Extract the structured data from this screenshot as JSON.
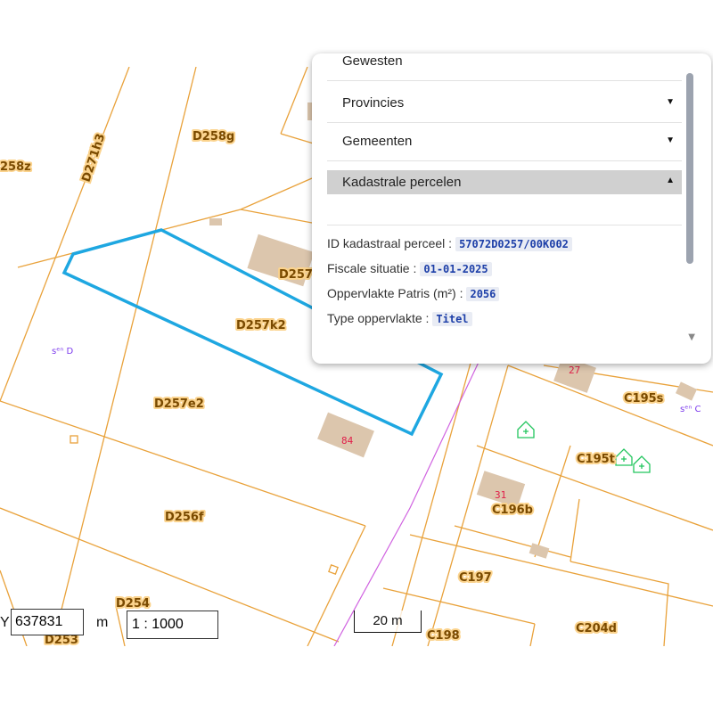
{
  "map": {
    "parcel_labels": [
      "D258g",
      "258z",
      "D271h3",
      "D257",
      "D257k2",
      "D257e2",
      "D256f",
      "D254",
      "D253",
      "C195s",
      "C195t",
      "C196b",
      "C197",
      "C198",
      "C204d"
    ],
    "house_numbers": [
      "84",
      "27",
      "31"
    ],
    "section_labels": [
      "sᵉⁿ D",
      "sᵉⁿ C"
    ],
    "selected_parcel": "D257k2",
    "colors": {
      "parcel_line": "#e9a23b",
      "highlight": "#1ea7e1",
      "building": "#dcc6ad",
      "road_line": "#d062e0",
      "label_halo": "#fbd38d",
      "label_text": "#7a4a00"
    }
  },
  "panel": {
    "sections": [
      {
        "label": "Gewesten",
        "expanded": false
      },
      {
        "label": "Provincies",
        "expanded": false
      },
      {
        "label": "Gemeenten",
        "expanded": false
      },
      {
        "label": "Kadastrale percelen",
        "expanded": true
      }
    ],
    "details": [
      {
        "label": "ID kadastraal perceel :",
        "value": "57072D0257/00K002"
      },
      {
        "label": "Fiscale situatie :",
        "value": "01-01-2025"
      },
      {
        "label": "Oppervlakte Patris (m²) :",
        "value": "2056"
      },
      {
        "label": "Type oppervlakte :",
        "value": "Titel"
      }
    ],
    "caret_down": "▼",
    "caret_up": "▲"
  },
  "controls": {
    "y_label": "Y",
    "y_value": "637831",
    "unit": "m",
    "scale_value": "1 : 1000",
    "scalebar_label": "20 m"
  }
}
